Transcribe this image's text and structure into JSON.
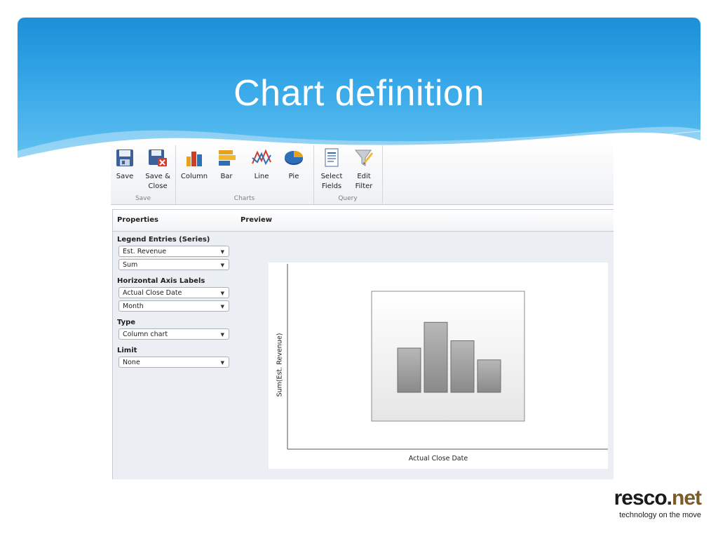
{
  "slide": {
    "title": "Chart definition"
  },
  "ribbon": {
    "groups": {
      "save": {
        "label": "Save",
        "buttons": {
          "save": "Save",
          "save_close": "Save &\nClose"
        }
      },
      "charts": {
        "label": "Charts",
        "buttons": {
          "column": "Column",
          "bar": "Bar",
          "line": "Line",
          "pie": "Pie"
        }
      },
      "query": {
        "label": "Query",
        "buttons": {
          "select_fields": "Select\nFields",
          "edit_filter": "Edit\nFilter"
        }
      }
    }
  },
  "properties": {
    "header": "Properties",
    "legend_entries": {
      "title": "Legend Entries (Series)",
      "field": "Est. Revenue",
      "aggregate": "Sum"
    },
    "horizontal_axis": {
      "title": "Horizontal Axis Labels",
      "field": "Actual Close Date",
      "grouping": "Month"
    },
    "type": {
      "title": "Type",
      "value": "Column chart"
    },
    "limit": {
      "title": "Limit",
      "value": "None"
    }
  },
  "preview": {
    "header": "Preview",
    "y_axis_title": "Sum(Est. Revenue)",
    "x_axis_title": "Actual Close Date"
  },
  "chart_data": {
    "type": "bar",
    "values": [
      0.6,
      0.95,
      0.7,
      0.44
    ]
  },
  "logo": {
    "part1": "resco",
    "part2": ".",
    "part3": "net",
    "tagline": "technology on the move"
  },
  "colors": {
    "header_blue": "#1b8fd8",
    "header_light": "#66c4f2",
    "logo_accent": "#7b5b2a"
  }
}
